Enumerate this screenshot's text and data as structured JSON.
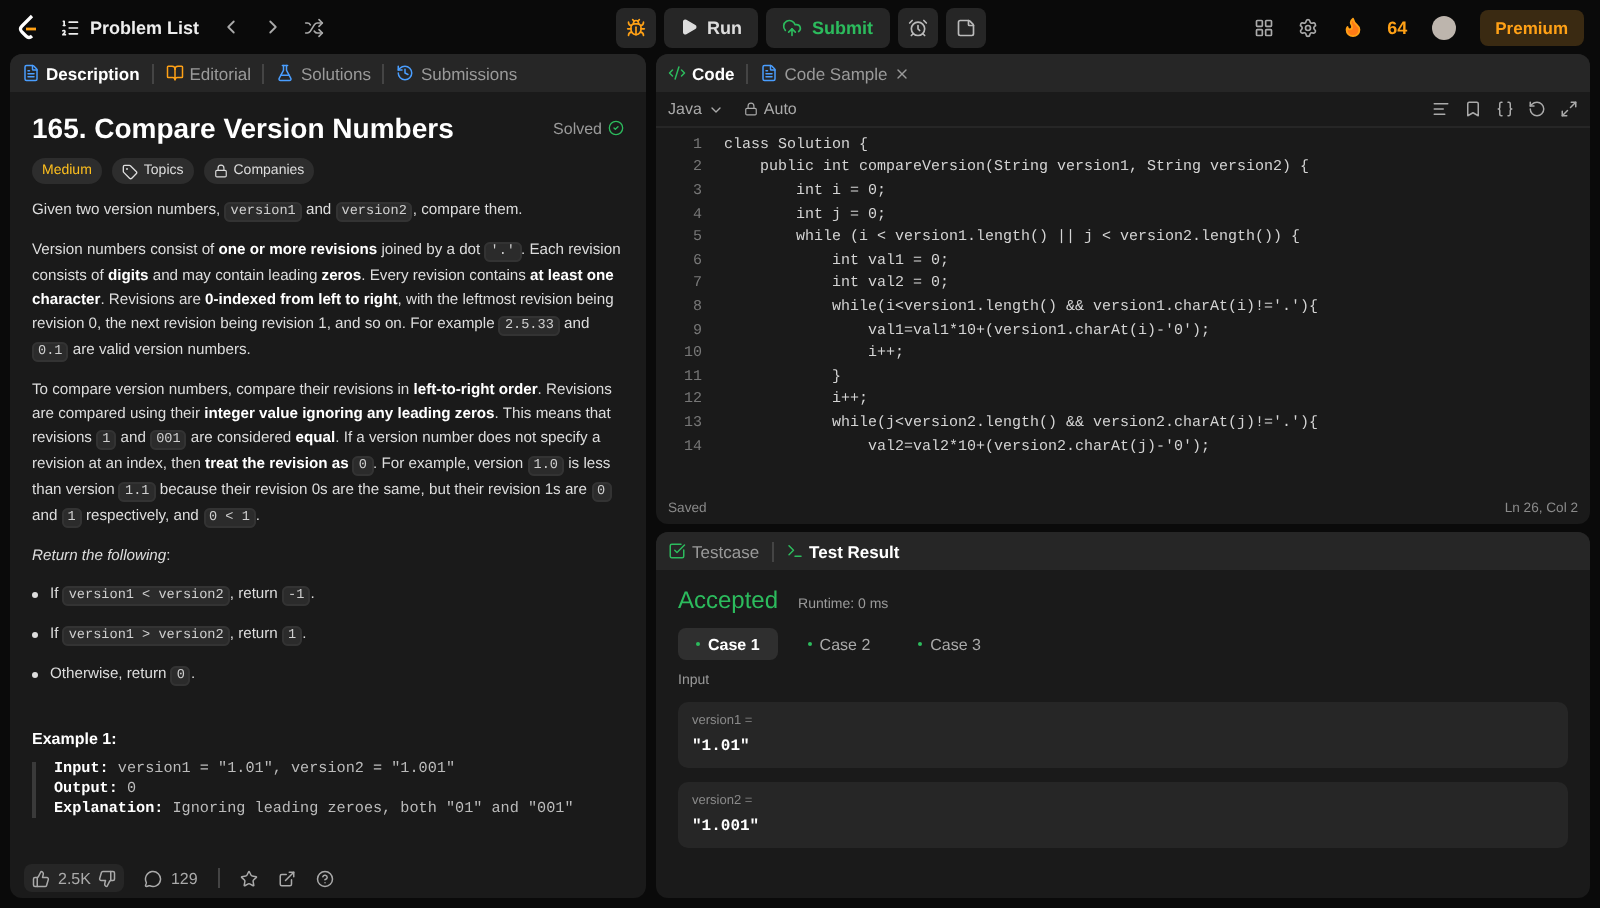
{
  "topbar": {
    "problem_list": "Problem List",
    "run": "Run",
    "submit": "Submit",
    "streak": "64",
    "premium": "Premium"
  },
  "left_tabs": [
    {
      "label": "Description",
      "selected": true
    },
    {
      "label": "Editorial",
      "selected": false
    },
    {
      "label": "Solutions",
      "selected": false
    },
    {
      "label": "Submissions",
      "selected": false
    }
  ],
  "problem": {
    "title": "165. Compare Version Numbers",
    "status": "Solved",
    "tags": [
      {
        "label": "Medium",
        "kind": "difficulty"
      },
      {
        "label": "Topics",
        "kind": "topics"
      },
      {
        "label": "Companies",
        "kind": "companies"
      }
    ]
  },
  "description": [
    {
      "kind": "text",
      "segments": [
        {
          "kind": "text",
          "text": "Given two version numbers, "
        },
        {
          "kind": "code",
          "text": "version1"
        },
        {
          "kind": "text",
          "text": " and "
        },
        {
          "kind": "code",
          "text": "version2"
        },
        {
          "kind": "text",
          "text": ", compare them."
        }
      ]
    },
    {
      "kind": "text",
      "segments": [
        {
          "kind": "text",
          "text": "Version numbers consist of **one or more revisions** joined by a dot "
        },
        {
          "kind": "code",
          "text": "'.'"
        },
        {
          "kind": "text",
          "text": ". Each revision consists of **digits** and may contain leading **zeros**. Every revision contains **at least one character**. Revisions are **0-indexed from left to right**, with the leftmost revision being revision 0, the next revision being revision 1, and so on. For example "
        },
        {
          "kind": "code",
          "text": "2.5.33"
        },
        {
          "kind": "text",
          "text": " and "
        },
        {
          "kind": "code",
          "text": "0.1"
        },
        {
          "kind": "text",
          "text": " are valid version numbers."
        }
      ]
    },
    {
      "kind": "text",
      "segments": [
        {
          "kind": "text",
          "text": "To compare version numbers, compare their revisions in **left-to-right order**. Revisions are compared using their **integer value ignoring any leading zeros**. This means that revisions "
        },
        {
          "kind": "code",
          "text": "1"
        },
        {
          "kind": "text",
          "text": " and "
        },
        {
          "kind": "code",
          "text": "001"
        },
        {
          "kind": "text",
          "text": " are considered **equal**. If a version number does not specify a revision at an index, then **treat the revision as** "
        },
        {
          "kind": "code",
          "text": "0"
        },
        {
          "kind": "text",
          "text": ". For example, version "
        },
        {
          "kind": "code",
          "text": "1.0"
        },
        {
          "kind": "text",
          "text": " is less than version "
        },
        {
          "kind": "code",
          "text": "1.1"
        },
        {
          "kind": "text",
          "text": " because their revision 0s are the same, but their revision 1s are "
        },
        {
          "kind": "code",
          "text": "0"
        },
        {
          "kind": "text",
          "text": " and "
        },
        {
          "kind": "code",
          "text": "1"
        },
        {
          "kind": "text",
          "text": " respectively, and "
        },
        {
          "kind": "code",
          "text": "0 < 1"
        },
        {
          "kind": "text",
          "text": "."
        }
      ]
    },
    {
      "kind": "italic",
      "segments": [
        {
          "kind": "text",
          "text": "Return the following"
        },
        {
          "kind": "plain",
          "text": ":"
        }
      ]
    },
    {
      "kind": "bullet",
      "segments": [
        {
          "kind": "text",
          "text": "If "
        },
        {
          "kind": "code",
          "text": "version1 < version2"
        },
        {
          "kind": "text",
          "text": ", return "
        },
        {
          "kind": "code",
          "text": "-1"
        },
        {
          "kind": "text",
          "text": "."
        }
      ]
    },
    {
      "kind": "bullet",
      "segments": [
        {
          "kind": "text",
          "text": "If "
        },
        {
          "kind": "code",
          "text": "version1 > version2"
        },
        {
          "kind": "text",
          "text": ", return "
        },
        {
          "kind": "code",
          "text": "1"
        },
        {
          "kind": "text",
          "text": "."
        }
      ]
    },
    {
      "kind": "bullet",
      "segments": [
        {
          "kind": "text",
          "text": "Otherwise, return "
        },
        {
          "kind": "code",
          "text": "0"
        },
        {
          "kind": "text",
          "text": "."
        }
      ]
    }
  ],
  "example": {
    "heading": "Example 1:",
    "lines": [
      {
        "label": "Input:",
        "value": "version1 = \"1.01\", version2 = \"1.001\""
      },
      {
        "label": "Output:",
        "value": "0"
      },
      {
        "label": "Explanation:",
        "value": "Ignoring leading zeroes, both \"01\" and \"001\""
      }
    ]
  },
  "footer": {
    "likes": "2.5K",
    "comments": "129"
  },
  "code_tabs": [
    {
      "label": "Code",
      "selected": true,
      "kind": "code"
    },
    {
      "label": "Code Sample",
      "selected": false,
      "kind": "sample"
    }
  ],
  "editor": {
    "language": "Java",
    "mode": "Auto",
    "status": "Saved",
    "cursor": "Ln 26, Col 2",
    "lines": [
      {
        "n": "1",
        "code": "class Solution {"
      },
      {
        "n": "2",
        "code": "    public int compareVersion(String version1, String version2) {"
      },
      {
        "n": "3",
        "code": "        int i = 0;"
      },
      {
        "n": "4",
        "code": "        int j = 0;"
      },
      {
        "n": "5",
        "code": "        while (i < version1.length() || j < version2.length()) {"
      },
      {
        "n": "6",
        "code": "            int val1 = 0;"
      },
      {
        "n": "7",
        "code": "            int val2 = 0;"
      },
      {
        "n": "8",
        "code": "            while(i<version1.length() && version1.charAt(i)!='.'){"
      },
      {
        "n": "9",
        "code": "                val1=val1*10+(version1.charAt(i)-'0');"
      },
      {
        "n": "10",
        "code": "                i++;"
      },
      {
        "n": "11",
        "code": "            }"
      },
      {
        "n": "12",
        "code": "            i++;"
      },
      {
        "n": "13",
        "code": "            while(j<version2.length() && version2.charAt(j)!='.'){"
      },
      {
        "n": "14",
        "code": "                val2=val2*10+(version2.charAt(j)-'0');"
      }
    ]
  },
  "test_tabs": [
    {
      "label": "Testcase",
      "selected": false,
      "kind": "testcase"
    },
    {
      "label": "Test Result",
      "selected": true,
      "kind": "result"
    }
  ],
  "result": {
    "verdict": "Accepted",
    "runtime": "Runtime: 0 ms",
    "cases": [
      {
        "label": "Case 1",
        "selected": true
      },
      {
        "label": "Case 2",
        "selected": false
      },
      {
        "label": "Case 3",
        "selected": false
      }
    ],
    "input_label": "Input",
    "inputs": [
      {
        "name": "version1 =",
        "value": "\"1.01\""
      },
      {
        "name": "version2 =",
        "value": "\"1.001\""
      }
    ]
  }
}
